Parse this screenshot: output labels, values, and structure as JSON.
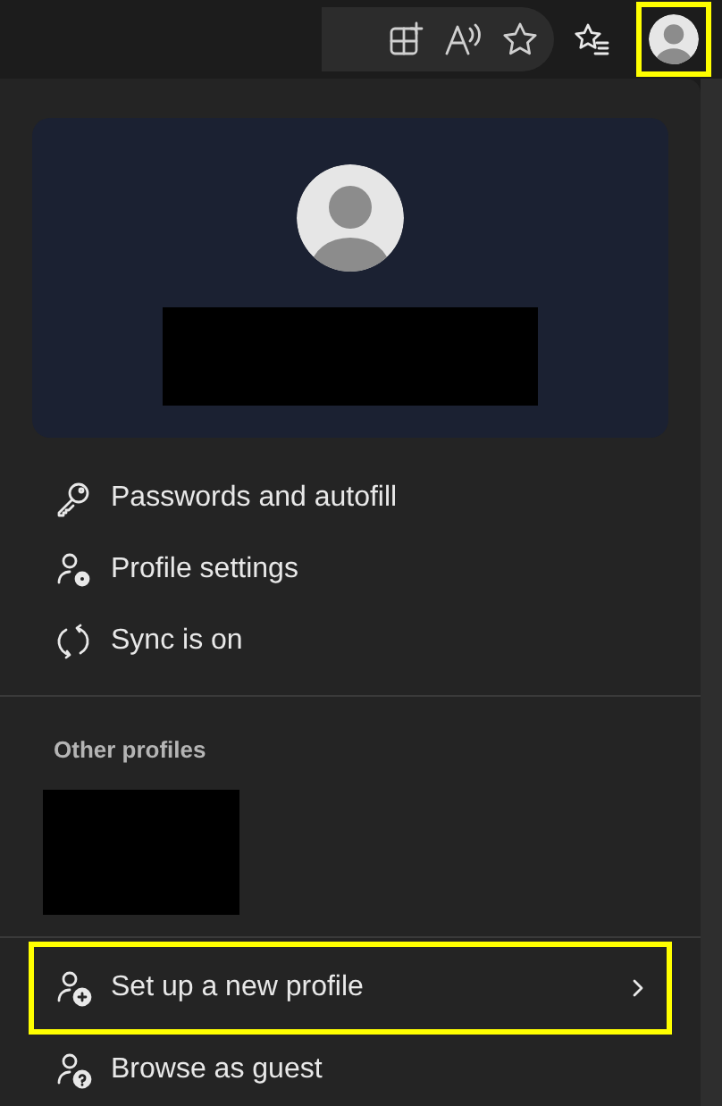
{
  "toolbar": {
    "buttons": [
      {
        "kind": "add-tab"
      },
      {
        "kind": "read-aloud"
      },
      {
        "kind": "favorite"
      },
      {
        "kind": "favorites-list"
      }
    ],
    "profile_button": {
      "highlighted": true
    }
  },
  "profile_card": {
    "name_redacted": true
  },
  "menu": [
    {
      "kind": "key",
      "label": "Passwords and autofill"
    },
    {
      "kind": "settings",
      "label": "Profile settings"
    },
    {
      "kind": "sync",
      "label": "Sync is on"
    }
  ],
  "other_profiles": {
    "heading": "Other profiles",
    "profile_redacted": true
  },
  "actions": [
    {
      "kind": "add",
      "label": "Set up a new profile",
      "highlighted": true,
      "submenu": true
    },
    {
      "kind": "guest",
      "label": "Browse as guest",
      "highlighted": false,
      "submenu": false
    }
  ]
}
